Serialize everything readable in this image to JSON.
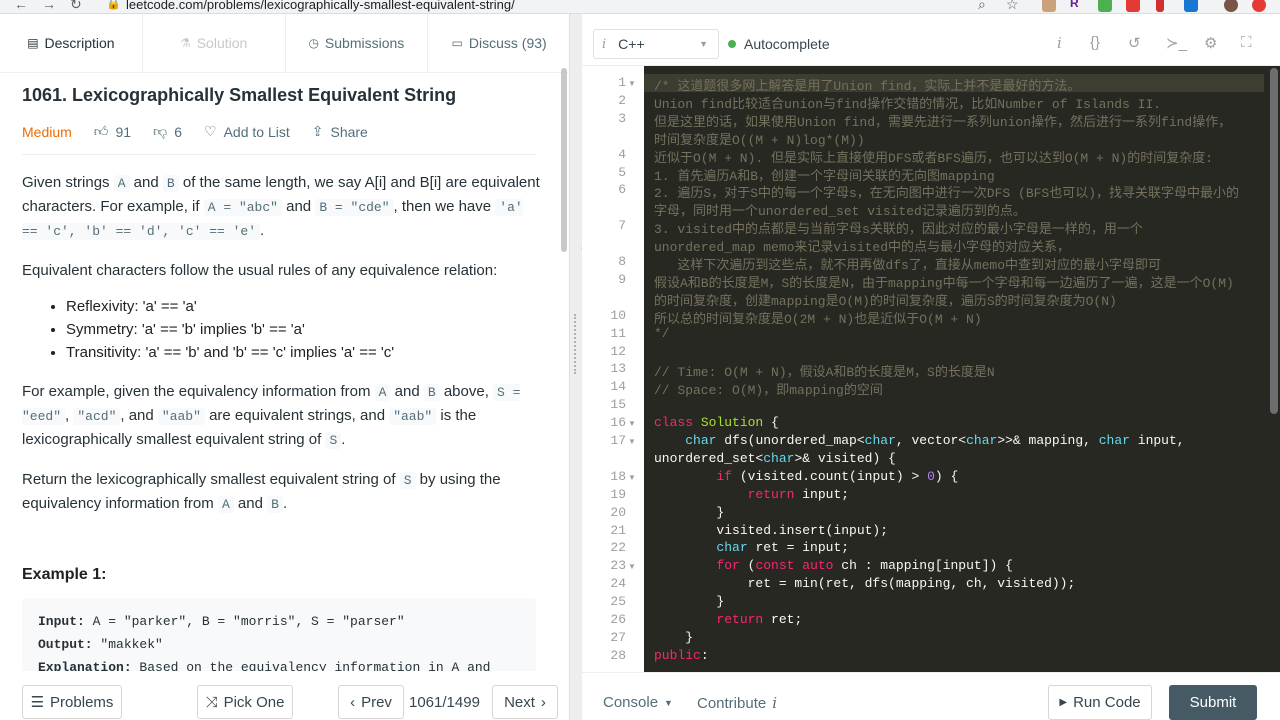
{
  "browser": {
    "url": "leetcode.com/problems/lexicographically-smallest-equivalent-string/",
    "profile_initial": "R"
  },
  "tabs": [
    {
      "label": "Description",
      "icon": "description-icon",
      "state": "active"
    },
    {
      "label": "Solution",
      "icon": "flask-icon",
      "state": "disabled"
    },
    {
      "label": "Submissions",
      "icon": "clock-icon",
      "state": "normal"
    },
    {
      "label": "Discuss (93)",
      "icon": "chat-icon",
      "state": "normal"
    }
  ],
  "problem": {
    "title": "1061. Lexicographically Smallest Equivalent String",
    "difficulty": "Medium",
    "likes": "91",
    "dislikes": "6",
    "add_to_list": "Add to List",
    "share": "Share",
    "p1_a": "Given strings ",
    "p1_codeA": "A",
    "p1_b": " and ",
    "p1_codeB": "B",
    "p1_c": " of the same length, we say A[i] and B[i] are equivalent characters. For example, if ",
    "p1_code1": "A = \"abc\"",
    "p1_d": " and ",
    "p1_code2": "B = \"cde\"",
    "p1_e": ", then we have ",
    "p1_code3": "'a' == 'c', 'b' == 'd', 'c' == 'e'",
    "p1_f": ".",
    "p2": "Equivalent characters follow the usual rules of any equivalence relation:",
    "rules": [
      "Reflexivity: 'a' == 'a'",
      "Symmetry: 'a' == 'b' implies 'b' == 'a'",
      "Transitivity: 'a' == 'b' and 'b' == 'c' implies 'a' == 'c'"
    ],
    "p3_a": "For example, given the equivalency information from ",
    "p3_codeA": "A",
    "p3_b": " and ",
    "p3_codeB": "B",
    "p3_c": " above, ",
    "p3_code1": "S = \"eed\"",
    "p3_d": ", ",
    "p3_code2": "\"acd\"",
    "p3_e": ", and ",
    "p3_code3": "\"aab\"",
    "p3_f": " are equivalent strings, and ",
    "p3_code4": "\"aab\"",
    "p3_g": " is the lexicographically smallest equivalent string of ",
    "p3_code5": "S",
    "p3_h": ".",
    "p4_a": "Return the lexicographically smallest equivalent string of ",
    "p4_code1": "S",
    "p4_b": " by using the equivalency information from ",
    "p4_code2": "A",
    "p4_c": " and ",
    "p4_code3": "B",
    "p4_d": ".",
    "example_title": "Example 1:",
    "ex_input_label": "Input:",
    "ex_input": " A = \"parker\", B = \"morris\", S = \"parser\"",
    "ex_output_label": "Output:",
    "ex_output": " \"makkek\"",
    "ex_expl_label": "Explanation:",
    "ex_expl": " Based on the equivalency information in A and"
  },
  "left_footer": {
    "problems": "Problems",
    "pick_one": "Pick One",
    "prev": "Prev",
    "counter": "1061/1499",
    "next": "Next"
  },
  "editor_toolbar": {
    "language": "C++",
    "autocomplete": "Autocomplete"
  },
  "code_lines": [
    {
      "n": "1",
      "fold": true,
      "text": "/* 这道题很多网上解答是用了Union find，实际上并不是最好的方法。",
      "cmt": true
    },
    {
      "n": "2",
      "text": "Union find比较适合union与find操作交错的情况，比如Number of Islands II.",
      "cmt": true
    },
    {
      "n": "3",
      "text": "但是这里的话，如果使用Union find，需要先进行一系列union操作，然后进行一系列find操作，",
      "cmt": true
    },
    {
      "n": "",
      "text": "时间复杂度是O((M + N)log*(M))",
      "cmt": true
    },
    {
      "n": "4",
      "text": "近似于O(M + N). 但是实际上直接使用DFS或者BFS遍历，也可以达到O(M + N)的时间复杂度:",
      "cmt": true
    },
    {
      "n": "5",
      "text": "1. 首先遍历A和B，创建一个字母间关联的无向图mapping",
      "cmt": true
    },
    {
      "n": "6",
      "text": "2. 遍历S，对于S中的每一个字母s，在无向图中进行一次DFS (BFS也可以)，找寻关联字母中最小的",
      "cmt": true
    },
    {
      "n": "",
      "text": "字母，同时用一个unordered_set visited记录遍历到的点。",
      "cmt": true
    },
    {
      "n": "7",
      "text": "3. visited中的点都是与当前字母s关联的，因此对应的最小字母是一样的，用一个",
      "cmt": true
    },
    {
      "n": "",
      "text": "unordered_map memo来记录visited中的点与最小字母的对应关系，",
      "cmt": true
    },
    {
      "n": "8",
      "text": "   这样下次遍历到这些点，就不用再做dfs了，直接从memo中查到对应的最小字母即可",
      "cmt": true
    },
    {
      "n": "9",
      "text": "假设A和B的长度是M，S的长度是N，由于mapping中每一个字母和每一边遍历了一遍，这是一个O(M)",
      "cmt": true
    },
    {
      "n": "",
      "text": "的时间复杂度，创建mapping是O(M)的时间复杂度，遍历S的时间复杂度为O(N)",
      "cmt": true
    },
    {
      "n": "10",
      "text": "所以总的时间复杂度是O(2M + N)也是近似于O(M + N)",
      "cmt": true
    },
    {
      "n": "11",
      "text": "*/",
      "cmt": true
    },
    {
      "n": "12",
      "text": ""
    },
    {
      "n": "13",
      "text": "// Time: O(M + N)，假设A和B的长度是M，S的长度是N",
      "cmt": true
    },
    {
      "n": "14",
      "text": "// Space: O(M)，即mapping的空间",
      "cmt": true
    },
    {
      "n": "15",
      "text": ""
    },
    {
      "n": "16",
      "fold": true,
      "html": "<span class='kw'>class</span> <span class='cls'>Solution</span> {"
    },
    {
      "n": "17",
      "fold": true,
      "html": "    <span class='ty'>char</span> dfs(unordered_map&lt;<span class='ty'>char</span>, vector&lt;<span class='ty'>char</span>&gt;&gt;&amp; mapping, <span class='ty'>char</span> input,"
    },
    {
      "n": "",
      "html": "unordered_set&lt;<span class='ty'>char</span>&gt;&amp; visited) {"
    },
    {
      "n": "18",
      "fold": true,
      "html": "        <span class='kw'>if</span> (visited.count(input) &gt; <span class='num'>0</span>) {"
    },
    {
      "n": "19",
      "html": "            <span class='kw'>return</span> input;"
    },
    {
      "n": "20",
      "html": "        }"
    },
    {
      "n": "21",
      "html": "        visited.insert(input);"
    },
    {
      "n": "22",
      "html": "        <span class='ty'>char</span> ret = input;"
    },
    {
      "n": "23",
      "fold": true,
      "html": "        <span class='kw'>for</span> (<span class='kw'>const</span> <span class='kw'>auto</span> ch : mapping[input]) {"
    },
    {
      "n": "24",
      "html": "            ret = min(ret, dfs(mapping, ch, visited));"
    },
    {
      "n": "25",
      "html": "        }"
    },
    {
      "n": "26",
      "html": "        <span class='kw'>return</span> ret;"
    },
    {
      "n": "27",
      "html": "    }"
    },
    {
      "n": "28",
      "html": "<span class='kw'>public</span>:"
    }
  ],
  "right_footer": {
    "console": "Console",
    "contribute": "Contribute",
    "run_code": "Run Code",
    "submit": "Submit"
  },
  "colors": {
    "accent_medium": "#ef6c00",
    "editor_bg": "#272822",
    "submit_bg": "#455a64",
    "autocomplete_dot": "#4caf50"
  }
}
